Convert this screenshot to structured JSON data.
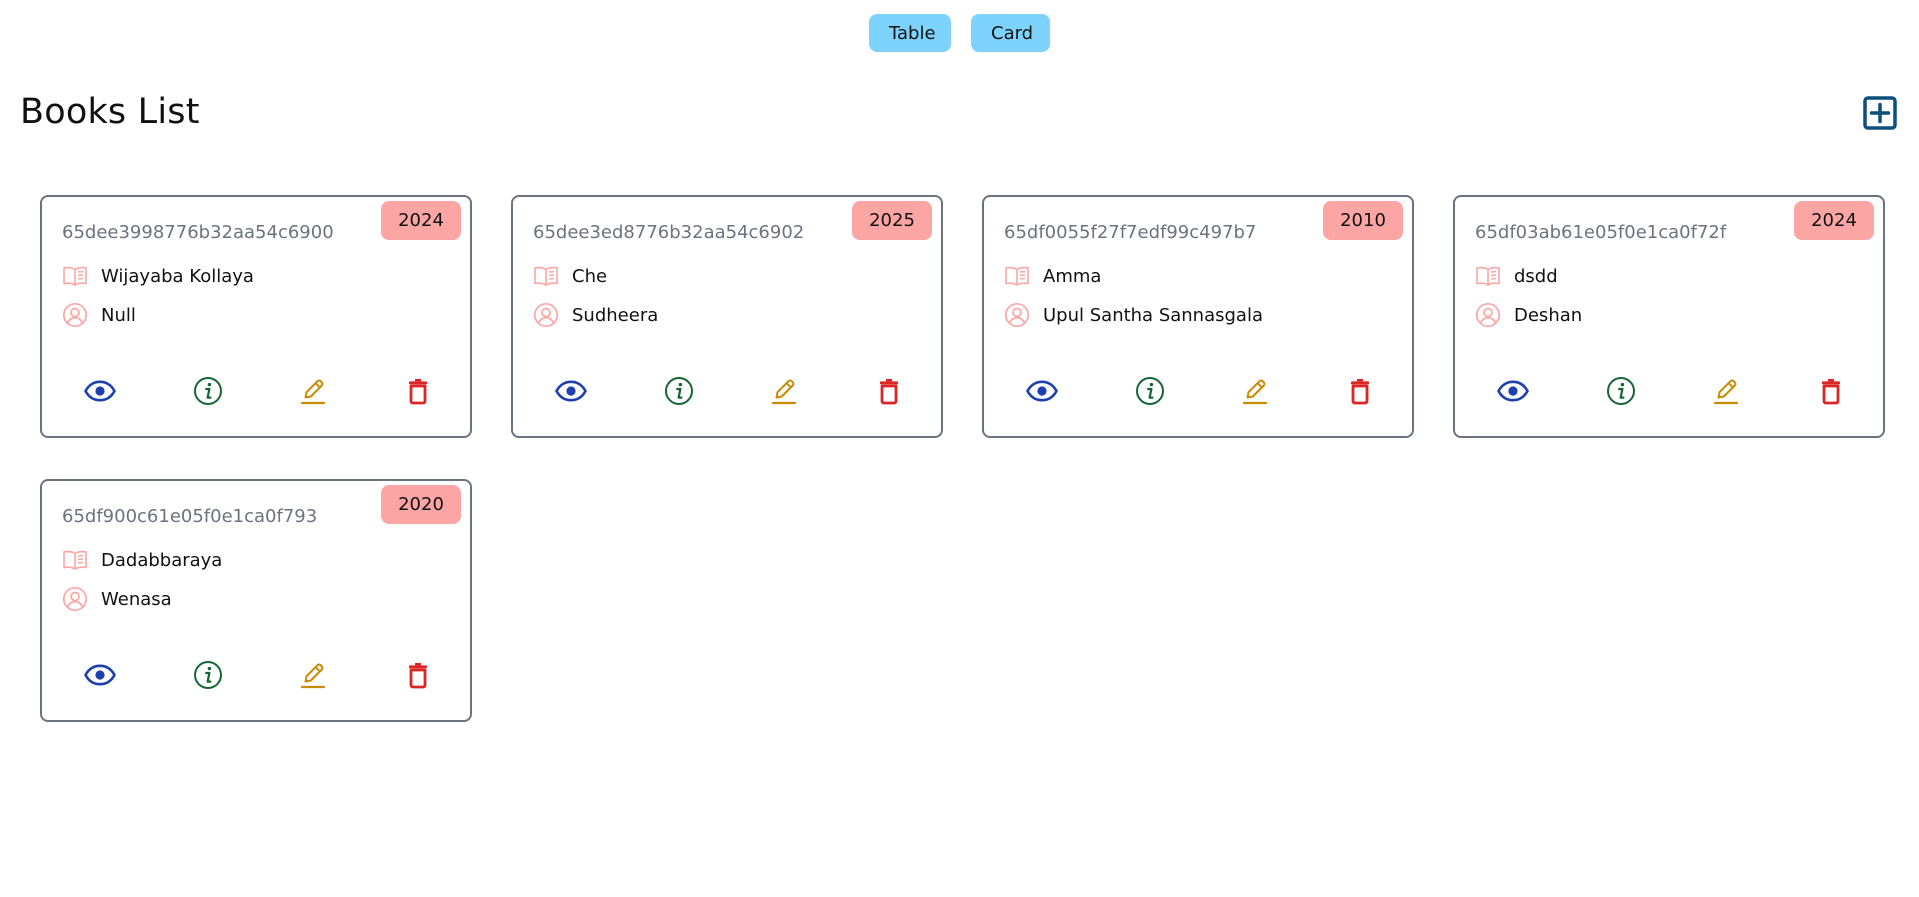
{
  "view_toggle": {
    "table_label": "Table",
    "card_label": "Card"
  },
  "page": {
    "title": "Books List"
  },
  "icons": {
    "add": "plus-square-icon",
    "title": "open-book-icon",
    "author": "user-circle-icon",
    "view": "eye-icon",
    "info": "info-circle-icon",
    "edit": "pencil-icon",
    "delete": "trash-icon"
  },
  "colors": {
    "toggle_bg": "#7dd3fc",
    "badge_bg": "#fca5a5",
    "add_icon": "#0b4f7a",
    "meta_icon": "#fca5a5",
    "view_icon": "#1e40af",
    "info_icon": "#166534",
    "edit_icon": "#ca8a04",
    "delete_icon": "#dc2626",
    "card_border": "#6b7280",
    "id_text": "#6b7280"
  },
  "books": [
    {
      "id": "65dee3998776b32aa54c6900",
      "year": "2024",
      "title": "Wijayaba Kollaya",
      "author": "Null"
    },
    {
      "id": "65dee3ed8776b32aa54c6902",
      "year": "2025",
      "title": "Che",
      "author": "Sudheera"
    },
    {
      "id": "65df0055f27f7edf99c497b7",
      "year": "2010",
      "title": "Amma",
      "author": "Upul Santha Sannasgala"
    },
    {
      "id": "65df03ab61e05f0e1ca0f72f",
      "year": "2024",
      "title": "dsdd",
      "author": "Deshan"
    },
    {
      "id": "65df900c61e05f0e1ca0f793",
      "year": "2020",
      "title": "Dadabbaraya",
      "author": "Wenasa"
    }
  ]
}
